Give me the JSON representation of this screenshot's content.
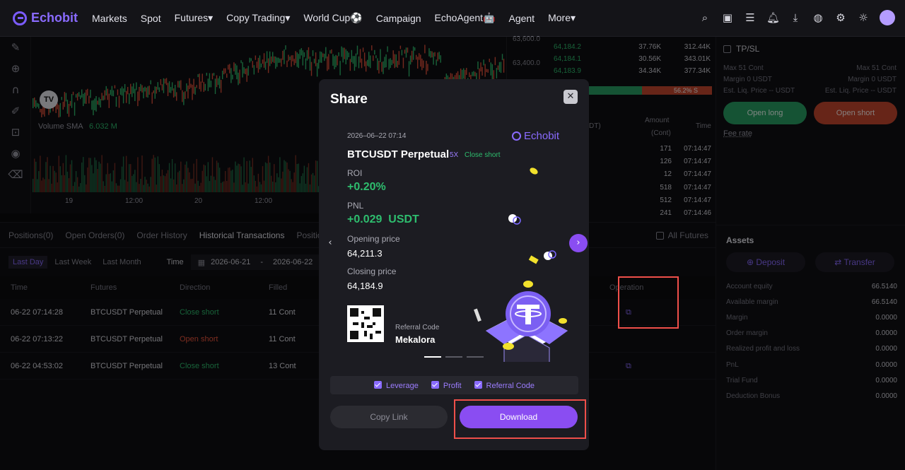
{
  "nav": {
    "logo": "Echobit",
    "items": [
      "Markets",
      "Spot",
      "Futures▾",
      "Copy Trading▾",
      "World Cup⚽",
      "Campaign",
      "EchoAgent🤖",
      "Agent",
      "More▾"
    ]
  },
  "chart": {
    "price_axis": [
      "63,600.0",
      "63,400.0"
    ],
    "volume_label": "Volume SMA",
    "volume_value": "6.032 M",
    "time_axis": [
      "19",
      "12:00",
      "20",
      "12:00"
    ]
  },
  "orderbook": {
    "rows": [
      {
        "price": "64,184.2",
        "amount": "37.76K",
        "total": "312.44K"
      },
      {
        "price": "64,184.1",
        "amount": "30.56K",
        "total": "343.01K"
      },
      {
        "price": "64,183.9",
        "amount": "34.34K",
        "total": "377.34K"
      }
    ],
    "ratio_label": "56.2% S",
    "ratio_short_fraction": 0.562,
    "trades_header": {
      "price": "DT)",
      "amount": "Amount",
      "amount_unit": "(Cont)",
      "time": "Time"
    },
    "trades": [
      {
        "amount": "171",
        "time": "07:14:47"
      },
      {
        "amount": "126",
        "time": "07:14:47"
      },
      {
        "amount": "12",
        "time": "07:14:47"
      },
      {
        "amount": "518",
        "time": "07:14:47"
      },
      {
        "amount": "512",
        "time": "07:14:47"
      },
      {
        "amount": "241",
        "time": "07:14:46"
      }
    ]
  },
  "right": {
    "tpsl": "TP/SL",
    "max_left": "Max 51 Cont",
    "margin_left": "Margin 0 USDT",
    "liq_left": "Est. Liq. Price -- USDT",
    "max_right": "Max 51 Cont",
    "margin_right": "Margin 0 USDT",
    "liq_right": "Est. Liq. Price -- USDT",
    "open_long": "Open long",
    "open_short": "Open short",
    "fee_rate": "Fee rate",
    "assets_title": "Assets",
    "deposit": "Deposit",
    "transfer": "Transfer",
    "asset_rows": [
      {
        "label": "Account equity",
        "value": "66.5140"
      },
      {
        "label": "Available margin",
        "value": "66.5140"
      },
      {
        "label": "Margin",
        "value": "0.0000"
      },
      {
        "label": "Order margin",
        "value": "0.0000"
      },
      {
        "label": "Realized profit and loss",
        "value": "0.0000"
      },
      {
        "label": "PnL",
        "value": "0.0000"
      },
      {
        "label": "Trial Fund",
        "value": "0.0000"
      },
      {
        "label": "Deduction Bonus",
        "value": "0.0000"
      }
    ]
  },
  "positions": {
    "tabs": [
      "Positions(0)",
      "Open Orders(0)",
      "Order History",
      "Historical Transactions",
      "Position"
    ],
    "all_futures": "All Futures",
    "chips": [
      "Last Day",
      "Last Week",
      "Last Month"
    ],
    "time_label": "Time",
    "date_from": "2026-06-21",
    "date_sep": "-",
    "date_to": "2026-06-22",
    "headers": [
      "Time",
      "Futures",
      "Direction",
      "Filled",
      "Operation"
    ],
    "rows": [
      {
        "time": "06-22 07:14:28",
        "futures": "BTCUSDT Perpetual",
        "direction": "Close short",
        "filled": "11 Cont"
      },
      {
        "time": "06-22 07:13:22",
        "futures": "BTCUSDT Perpetual",
        "direction": "Open short",
        "filled": "11 Cont"
      },
      {
        "time": "06-22 04:53:02",
        "futures": "BTCUSDT Perpetual",
        "direction": "Close short",
        "filled": "13 Cont"
      }
    ]
  },
  "modal": {
    "title": "Share",
    "card": {
      "datetime": "2026–06–22 07:14",
      "brand": "Echobit",
      "symbol": "BTCUSDT Perpetual",
      "leverage": "5X",
      "side": "Close short",
      "roi_label": "ROI",
      "roi_value": "+0.20%",
      "pnl_label": "PNL",
      "pnl_value": "+0.029  USDT",
      "open_label": "Opening price",
      "open_value": "64,211.3",
      "close_label": "Closing price",
      "close_value": "64,184.9",
      "ref_label": "Referral Code",
      "ref_value": "Mekalora"
    },
    "options": [
      "Leverage",
      "Profit",
      "Referral Code"
    ],
    "copy_link": "Copy Link",
    "download": "Download"
  }
}
